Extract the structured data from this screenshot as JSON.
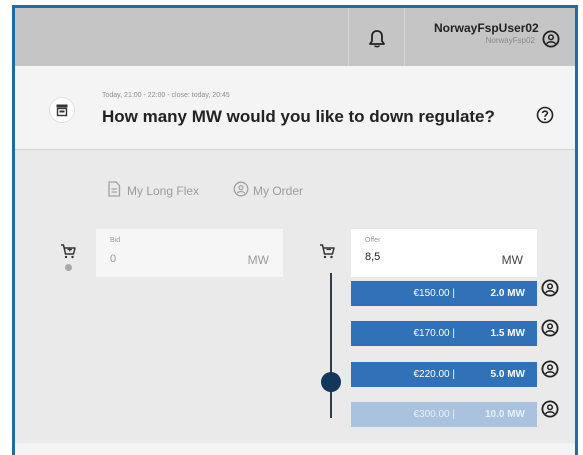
{
  "header": {
    "user_name": "NorwayFspUser02",
    "user_org": "NorwayFsp02",
    "icons": [
      "bell-icon",
      "user-circle-icon"
    ]
  },
  "title_section": {
    "time_info": "Today, 21:00 - 22:00 - close: today, 20:45",
    "title": "How many MW would you like to down regulate?",
    "icons": [
      "shop-icon",
      "help-icon"
    ]
  },
  "tabs": [
    {
      "label": "My Long Flex",
      "icon": "document-icon"
    },
    {
      "label": "My Order",
      "icon": "user-circle-icon"
    }
  ],
  "bid": {
    "label": "Bid",
    "value": "0",
    "unit": "MW"
  },
  "offer": {
    "label": "Offer",
    "value": "8,5",
    "unit": "MW",
    "rows": [
      {
        "price": "€150.00 |",
        "mw": "2.0 MW",
        "active": true
      },
      {
        "price": "€170.00 |",
        "mw": "1.5 MW",
        "active": true
      },
      {
        "price": "€220.00 |",
        "mw": "5.0 MW",
        "active": true
      },
      {
        "price": "€300.00 |",
        "mw": "10.0 MW",
        "active": false
      }
    ]
  },
  "colors": {
    "accent": "#3071b7",
    "inactive_offer": "#a9c2e0",
    "slider_dot": "#12375c",
    "frame_border": "#1f6ba5"
  }
}
